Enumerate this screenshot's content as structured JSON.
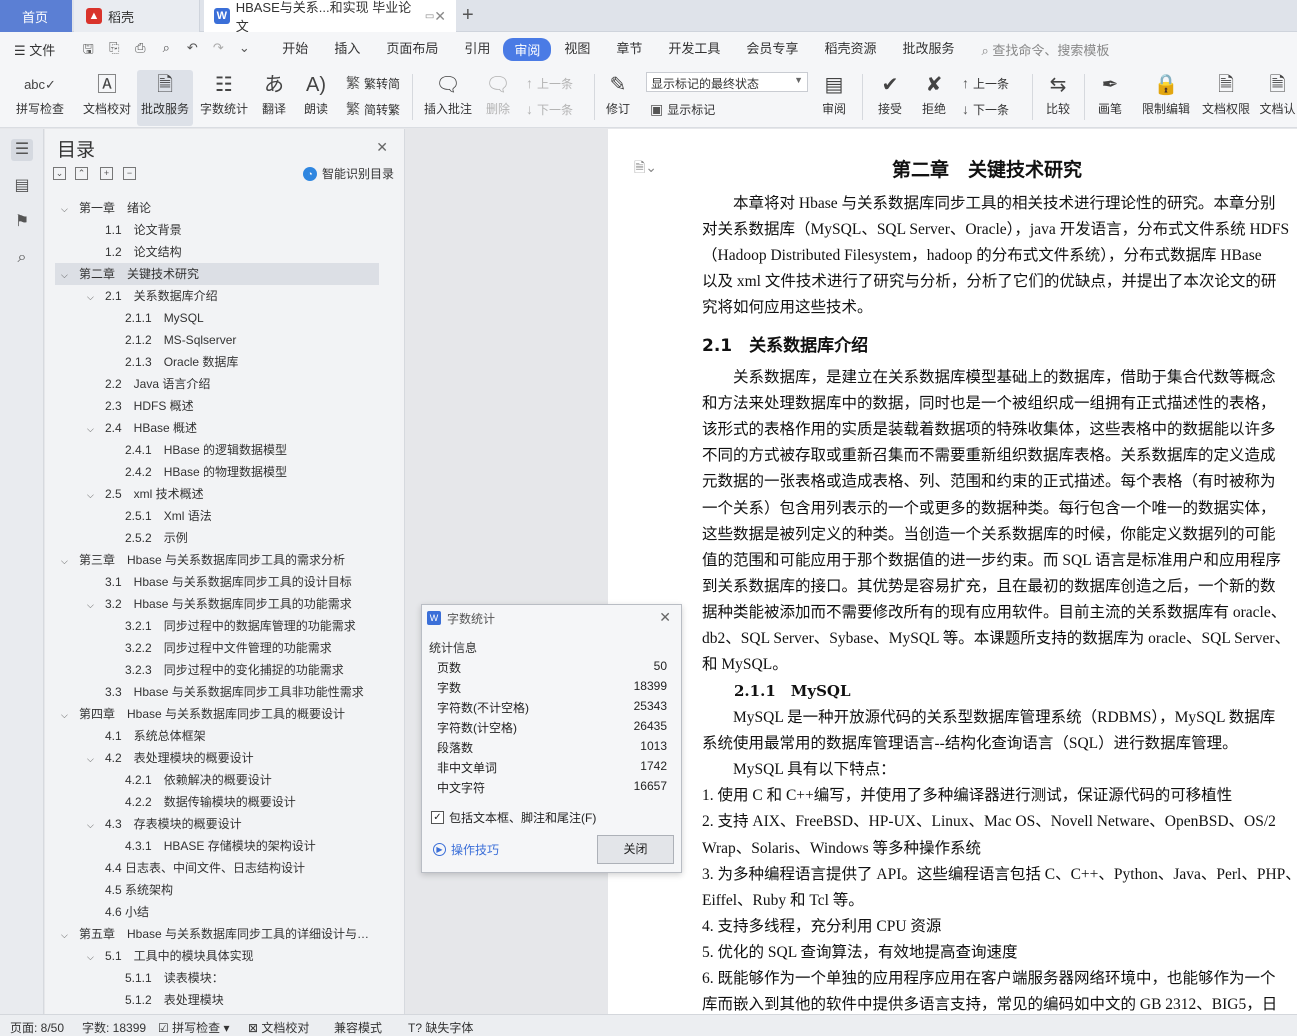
{
  "tabs": {
    "home": "首页",
    "daoke": "稻壳",
    "doc": "HBASE与关系...和实现 毕业论文",
    "new_tab": "+"
  },
  "menubar": {
    "file": "文件",
    "items": [
      "开始",
      "插入",
      "页面布局",
      "引用",
      "审阅",
      "视图",
      "章节",
      "开发工具",
      "会员专享",
      "稻壳资源",
      "批改服务"
    ],
    "active": "审阅",
    "search": "查找命令、搜索模板"
  },
  "ribbon": {
    "spellcheck": "拼写检查",
    "proofread": "文档校对",
    "grading": "批改服务",
    "wordcount": "字数统计",
    "translate": "翻译",
    "read_aloud": "朗读",
    "trad_to_simp": "繁转简",
    "simp_to_trad": "简转繁",
    "insert_comment": "插入批注",
    "delete": "删除",
    "prev": "上一条",
    "next": "下一条",
    "track_changes": "修订",
    "markup_select": "显示标记的最终状态",
    "show_markup": "显示标记",
    "review": "审阅",
    "accept": "接受",
    "reject": "拒绝",
    "prev2": "上一条",
    "next2": "下一条",
    "compare": "比较",
    "ink": "画笔",
    "restrict": "限制编辑",
    "permissions": "文档权限",
    "cert": "文档认"
  },
  "nav": {
    "title": "目录",
    "smart": "智能识别目录",
    "items": [
      {
        "t": "第一章　绪论",
        "lvl": 0,
        "toggle": "⌵"
      },
      {
        "t": "1.1　论文背景",
        "lvl": 1,
        "toggle": ""
      },
      {
        "t": "1.2　论文结构",
        "lvl": 1,
        "toggle": ""
      },
      {
        "t": "第二章　关键技术研究",
        "lvl": 0,
        "toggle": "⌵",
        "sel": true
      },
      {
        "t": "2.1　关系数据库介绍",
        "lvl": 1,
        "toggle": "⌵"
      },
      {
        "t": "2.1.1　MySQL",
        "lvl": 2,
        "toggle": ""
      },
      {
        "t": "2.1.2　MS-Sqlserver",
        "lvl": 2,
        "toggle": ""
      },
      {
        "t": "2.1.3　Oracle 数据库",
        "lvl": 2,
        "toggle": ""
      },
      {
        "t": "2.2　Java 语言介绍",
        "lvl": 1,
        "toggle": ""
      },
      {
        "t": "2.3　HDFS 概述",
        "lvl": 1,
        "toggle": ""
      },
      {
        "t": "2.4　HBase 概述",
        "lvl": 1,
        "toggle": "⌵"
      },
      {
        "t": "2.4.1　HBase 的逻辑数据模型",
        "lvl": 2,
        "toggle": ""
      },
      {
        "t": "2.4.2　HBase 的物理数据模型",
        "lvl": 2,
        "toggle": ""
      },
      {
        "t": "2.5　xml 技术概述",
        "lvl": 1,
        "toggle": "⌵"
      },
      {
        "t": "2.5.1　Xml 语法",
        "lvl": 2,
        "toggle": ""
      },
      {
        "t": "2.5.2　示例",
        "lvl": 2,
        "toggle": ""
      },
      {
        "t": "第三章　Hbase 与关系数据库同步工具的需求分析",
        "lvl": 0,
        "toggle": "⌵"
      },
      {
        "t": "3.1　Hbase 与关系数据库同步工具的设计目标",
        "lvl": 1,
        "toggle": ""
      },
      {
        "t": "3.2　Hbase 与关系数据库同步工具的功能需求",
        "lvl": 1,
        "toggle": "⌵"
      },
      {
        "t": "3.2.1　同步过程中的数据库管理的功能需求",
        "lvl": 2,
        "toggle": ""
      },
      {
        "t": "3.2.2　同步过程中文件管理的功能需求",
        "lvl": 2,
        "toggle": ""
      },
      {
        "t": "3.2.3　同步过程中的变化捕捉的功能需求",
        "lvl": 2,
        "toggle": ""
      },
      {
        "t": "3.3　Hbase 与关系数据库同步工具非功能性需求",
        "lvl": 1,
        "toggle": ""
      },
      {
        "t": "第四章　Hbase 与关系数据库同步工具的概要设计",
        "lvl": 0,
        "toggle": "⌵"
      },
      {
        "t": "4.1　系统总体框架",
        "lvl": 1,
        "toggle": ""
      },
      {
        "t": "4.2　表处理模块的概要设计",
        "lvl": 1,
        "toggle": "⌵"
      },
      {
        "t": "4.2.1　依赖解决的概要设计",
        "lvl": 2,
        "toggle": ""
      },
      {
        "t": "4.2.2　数据传输模块的概要设计",
        "lvl": 2,
        "toggle": ""
      },
      {
        "t": "4.3　存表模块的概要设计",
        "lvl": 1,
        "toggle": "⌵"
      },
      {
        "t": "4.3.1　HBASE 存储模块的架构设计",
        "lvl": 2,
        "toggle": ""
      },
      {
        "t": "4.4 日志表、中间文件、日志结构设计",
        "lvl": 1,
        "toggle": ""
      },
      {
        "t": "4.5 系统架构",
        "lvl": 1,
        "toggle": ""
      },
      {
        "t": "4.6 小结",
        "lvl": 1,
        "toggle": ""
      },
      {
        "t": "第五章　Hbase 与关系数据库同步工具的详细设计与…",
        "lvl": 0,
        "toggle": "⌵"
      },
      {
        "t": "5.1　工具中的模块具体实现",
        "lvl": 1,
        "toggle": "⌵"
      },
      {
        "t": "5.1.1　读表模块：",
        "lvl": 2,
        "toggle": ""
      },
      {
        "t": "5.1.2　表处理模块",
        "lvl": 2,
        "toggle": ""
      }
    ]
  },
  "document": {
    "h1": "第二章　关键技术研究",
    "intro": [
      "　　本章将对 Hbase 与关系数据库同步工具的相关技术进行理论性的研究。本章分别",
      "对关系数据库（MySQL、SQL Server、Oracle），java 开发语言，分布式文件系统 HDFS",
      "（Hadoop Distributed Filesystem，hadoop 的分布式文件系统），分布式数据库 HBase",
      "以及 xml 文件技术进行了研究与分析，分析了它们的优缺点，并提出了本次论文的研",
      "究将如何应用这些技术。"
    ],
    "h2": "2.1　关系数据库介绍",
    "body": [
      "　　关系数据库，是建立在关系数据库模型基础上的数据库，借助于集合代数等概念",
      "和方法来处理数据库中的数据，同时也是一个被组织成一组拥有正式描述性的表格，",
      "该形式的表格作用的实质是装载着数据项的特殊收集体，这些表格中的数据能以许多",
      "不同的方式被存取或重新召集而不需要重新组织数据库表格。关系数据库的定义造成",
      "元数据的一张表格或造成表格、列、范围和约束的正式描述。每个表格（有时被称为",
      "一个关系）包含用列表示的一个或更多的数据种类。每行包含一个唯一的数据实体，",
      "这些数据是被列定义的种类。当创造一个关系数据库的时候，你能定义数据列的可能",
      "值的范围和可能应用于那个数据值的进一步约束。而 SQL 语言是标准用户和应用程序",
      "到关系数据库的接口。其优势是容易扩充，且在最初的数据库创造之后，一个新的数",
      "据种类能被添加而不需要修改所有的现有应用软件。目前主流的关系数据库有 oracle、",
      "db2、SQL Server、Sybase、MySQL 等。本课题所支持的数据库为 oracle、SQL Server、",
      "和 MySQL。"
    ],
    "h3": "2.1.1　MySQL",
    "mysql": [
      "　　MySQL 是一种开放源代码的关系型数据库管理系统（RDBMS），MySQL 数据库",
      "系统使用最常用的数据库管理语言--结构化查询语言（SQL）进行数据库管理。",
      "　　MySQL 具有以下特点：",
      "1. 使用 C 和 C++编写，并使用了多种编译器进行测试，保证源代码的可移植性",
      "2. 支持 AIX、FreeBSD、HP-UX、Linux、Mac OS、Novell Netware、OpenBSD、OS/2",
      "Wrap、Solaris、Windows 等多种操作系统",
      "3. 为多种编程语言提供了 API。这些编程语言包括 C、C++、Python、Java、Perl、PHP、",
      "Eiffel、Ruby 和 Tcl 等。",
      "4. 支持多线程，充分利用 CPU 资源",
      "5. 优化的 SQL 查询算法，有效地提高查询速度",
      "6. 既能够作为一个单独的应用程序应用在客户端服务器网络环境中，也能够作为一个",
      "库而嵌入到其他的软件中提供多语言支持，常见的编码如中文的 GB 2312、BIG5，日"
    ]
  },
  "dialog": {
    "title": "字数统计",
    "section": "统计信息",
    "rows": [
      {
        "label": "页数",
        "value": "50"
      },
      {
        "label": "字数",
        "value": "18399"
      },
      {
        "label": "字符数(不计空格)",
        "value": "25343"
      },
      {
        "label": "字符数(计空格)",
        "value": "26435"
      },
      {
        "label": "段落数",
        "value": "1013"
      },
      {
        "label": "非中文单词",
        "value": "1742"
      },
      {
        "label": "中文字符",
        "value": "16657"
      }
    ],
    "include": "包括文本框、脚注和尾注(F)",
    "tips": "操作技巧",
    "close": "关闭"
  },
  "statusbar": {
    "page": "页面: 8/50",
    "words": "字数: 18399",
    "spell": "拼写检查",
    "proof": "文档校对",
    "compat": "兼容模式",
    "missing_font": "缺失字体"
  },
  "colors": {
    "accent": "#4a7be5",
    "home_tab": "#5b7fd4",
    "wps_red": "#d9332b"
  }
}
